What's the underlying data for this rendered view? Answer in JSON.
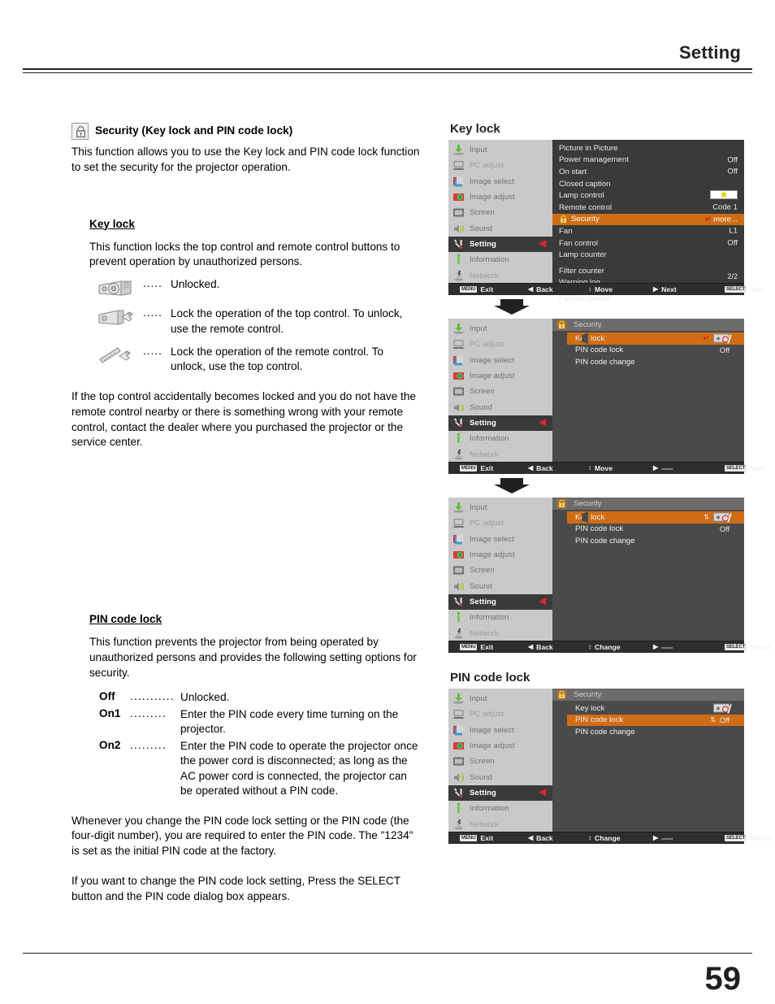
{
  "header": {
    "title": "Setting"
  },
  "footer": {
    "page_number": "59"
  },
  "left": {
    "section_title": "Security (Key lock and PIN code lock)",
    "section_icon": "padlock-icon",
    "intro": "This function allows you to use the Key lock and PIN code lock function to set the security for the projector operation.",
    "keylock": {
      "heading": "Key lock",
      "body": "This function locks the top control and remote control buttons to prevent operation by unauthorized persons.",
      "items": [
        {
          "icon": "projector-unlocked-icon",
          "dots": ".....",
          "text": "Unlocked."
        },
        {
          "icon": "projector-key-icon",
          "dots": ".....",
          "text": "Lock the operation of the top control. To unlock, use the remote control."
        },
        {
          "icon": "remote-key-icon",
          "dots": ".....",
          "text": "Lock the operation of the remote control. To unlock, use the top control."
        }
      ],
      "note": "If the top control accidentally becomes locked and you do not have the remote control nearby or there is something wrong with your remote control, contact the dealer where you purchased the projector or the service center."
    },
    "pincode": {
      "heading": "PIN code lock",
      "body": "This function prevents the projector from being operated by unauthorized persons and provides the following setting options for security.",
      "options": [
        {
          "key": "Off",
          "dots": "...........",
          "text": "Unlocked."
        },
        {
          "key": "On1",
          "dots": ".........",
          "text": "Enter the PIN code every time turning on the projector."
        },
        {
          "key": "On2",
          "dots": ".........",
          "text": "Enter the PIN code to operate the projector once the power cord is disconnected; as long as the AC power cord is connected, the projector can be operated without a PIN code."
        }
      ],
      "note1": "Whenever you change the PIN code lock setting or the PIN code (the four-digit number), you are required to enter the PIN code. The \"1234\" is set as the initial PIN code at the factory.",
      "note2": "If you want to change the PIN code lock setting, Press the SELECT button and the PIN code dialog box appears."
    }
  },
  "osd": {
    "caption_keylock": "Key lock",
    "caption_pincode": "PIN code lock",
    "sidebar": [
      {
        "label": "Input",
        "icon": "input-icon",
        "state": "normal"
      },
      {
        "label": "PC adjust",
        "icon": "pc-adjust-icon",
        "state": "dim"
      },
      {
        "label": "Image select",
        "icon": "image-select-icon",
        "state": "normal"
      },
      {
        "label": "Image adjust",
        "icon": "image-adjust-icon",
        "state": "normal"
      },
      {
        "label": "Screen",
        "icon": "screen-icon",
        "state": "normal"
      },
      {
        "label": "Sound",
        "icon": "sound-icon",
        "state": "normal"
      },
      {
        "label": "Setting",
        "icon": "setting-icon",
        "state": "active"
      },
      {
        "label": "Information",
        "icon": "information-icon",
        "state": "normal"
      },
      {
        "label": "Network",
        "icon": "network-icon",
        "state": "dim"
      }
    ],
    "panel1": {
      "rows": [
        {
          "name": "Picture in Picture",
          "value": ""
        },
        {
          "name": "Power management",
          "value": "Off"
        },
        {
          "name": "On start",
          "value": "Off"
        },
        {
          "name": "Closed caption",
          "value": ""
        },
        {
          "name": "Lamp control",
          "value": "__LAMP__"
        },
        {
          "name": "Remote control",
          "value": "Code 1"
        },
        {
          "name": "Security",
          "value": "more...",
          "selected": true,
          "icon": "padlock-icon"
        },
        {
          "name": "Fan",
          "value": "L1"
        },
        {
          "name": "Fan control",
          "value": "Off"
        },
        {
          "name": "Lamp counter",
          "value": ""
        },
        {
          "name": "Filter counter",
          "value": "",
          "spaced": true
        },
        {
          "name": "Warning log",
          "value": ""
        },
        {
          "name": "Factory default",
          "value": "",
          "spaced": true
        }
      ],
      "page_indicator": "2/2",
      "bar": [
        {
          "key": "MENU",
          "label": "Exit"
        },
        {
          "key": "",
          "arrow": "◀",
          "label": "Back"
        },
        {
          "key": "",
          "arrow": "↕",
          "label": "Move"
        },
        {
          "key": "",
          "arrow": "▶",
          "label": "Next"
        },
        {
          "key": "SELECT",
          "label": "Next"
        }
      ]
    },
    "panel2": {
      "title": "Security",
      "title_icon": "padlock-icon",
      "rows": [
        {
          "name": "Key lock",
          "value": "__KEYICON__",
          "selected": true,
          "ret": true
        },
        {
          "name": "PIN code lock",
          "value": "Off"
        },
        {
          "name": "PIN code change",
          "value": ""
        }
      ],
      "bar": [
        {
          "key": "MENU",
          "label": "Exit"
        },
        {
          "key": "",
          "arrow": "◀",
          "label": "Back"
        },
        {
          "key": "",
          "arrow": "↕",
          "label": "Move"
        },
        {
          "key": "",
          "arrow": "▶",
          "label": "-----"
        },
        {
          "key": "SELECT",
          "label": "Next"
        }
      ]
    },
    "panel3": {
      "title": "Security",
      "title_icon": "padlock-icon",
      "rows": [
        {
          "name": "Key lock",
          "value": "__KEYICON__",
          "selected": true,
          "updown": true
        },
        {
          "name": "PIN code lock",
          "value": "Off"
        },
        {
          "name": "PIN code change",
          "value": ""
        }
      ],
      "bar": [
        {
          "key": "MENU",
          "label": "Exit"
        },
        {
          "key": "",
          "arrow": "◀",
          "label": "Back"
        },
        {
          "key": "",
          "arrow": "↕",
          "label": "Change"
        },
        {
          "key": "",
          "arrow": "▶",
          "label": "-----"
        },
        {
          "key": "SELECT",
          "label": "Select"
        }
      ]
    },
    "panel4": {
      "title": "Security",
      "title_icon": "padlock-icon",
      "rows": [
        {
          "name": "Key lock",
          "value": "__KEYICON__"
        },
        {
          "name": "PIN code lock",
          "value": "Off",
          "selected": true,
          "updown": true
        },
        {
          "name": "PIN code change",
          "value": ""
        }
      ],
      "bar": [
        {
          "key": "MENU",
          "label": "Exit"
        },
        {
          "key": "",
          "arrow": "◀",
          "label": "Back"
        },
        {
          "key": "",
          "arrow": "↕",
          "label": "Change"
        },
        {
          "key": "",
          "arrow": "▶",
          "label": "-----"
        },
        {
          "key": "SELECT",
          "label": "Select"
        }
      ]
    }
  },
  "colors": {
    "highlight_orange": "#cf6d16",
    "sidebar_gray": "#c9c9c9",
    "panel_gray": "#3a3a3a",
    "caret_red": "#e8232a",
    "text_black": "#231f20"
  }
}
